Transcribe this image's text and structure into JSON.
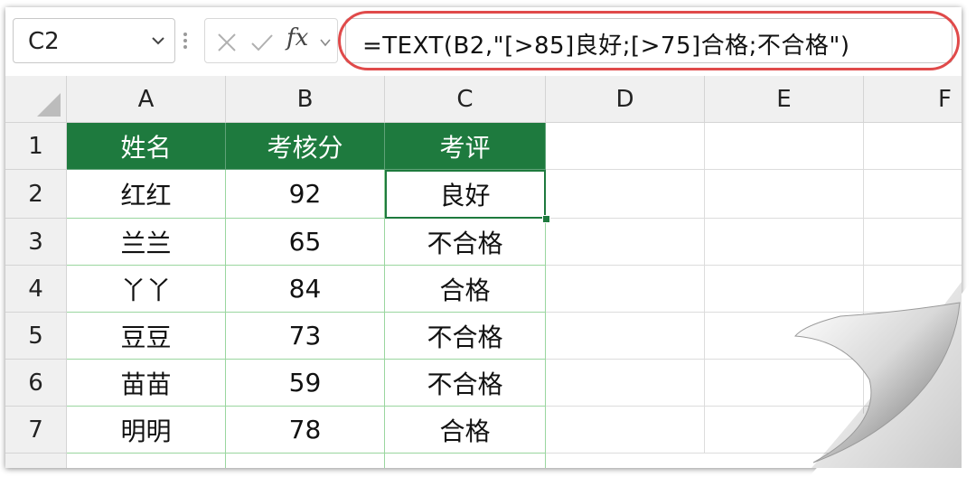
{
  "formula_bar": {
    "name_box": "C2",
    "fx_label": "fx",
    "formula": "=TEXT(B2,\"[>85]良好;[>75]合格;不合格\")"
  },
  "columns": [
    "A",
    "B",
    "C",
    "D",
    "E",
    "F"
  ],
  "rows": [
    "1",
    "2",
    "3",
    "4",
    "5",
    "6",
    "7"
  ],
  "table": {
    "headers": [
      "姓名",
      "考核分",
      "考评"
    ],
    "data": [
      [
        "红红",
        "92",
        "良好"
      ],
      [
        "兰兰",
        "65",
        "不合格"
      ],
      [
        "丫丫",
        "84",
        "合格"
      ],
      [
        "豆豆",
        "73",
        "不合格"
      ],
      [
        "苗苗",
        "59",
        "不合格"
      ],
      [
        "明明",
        "78",
        "合格"
      ]
    ]
  },
  "colors": {
    "header_fill": "#1e7a3e",
    "table_border": "#9ad69f",
    "highlight_oval": "#e04a4a"
  }
}
